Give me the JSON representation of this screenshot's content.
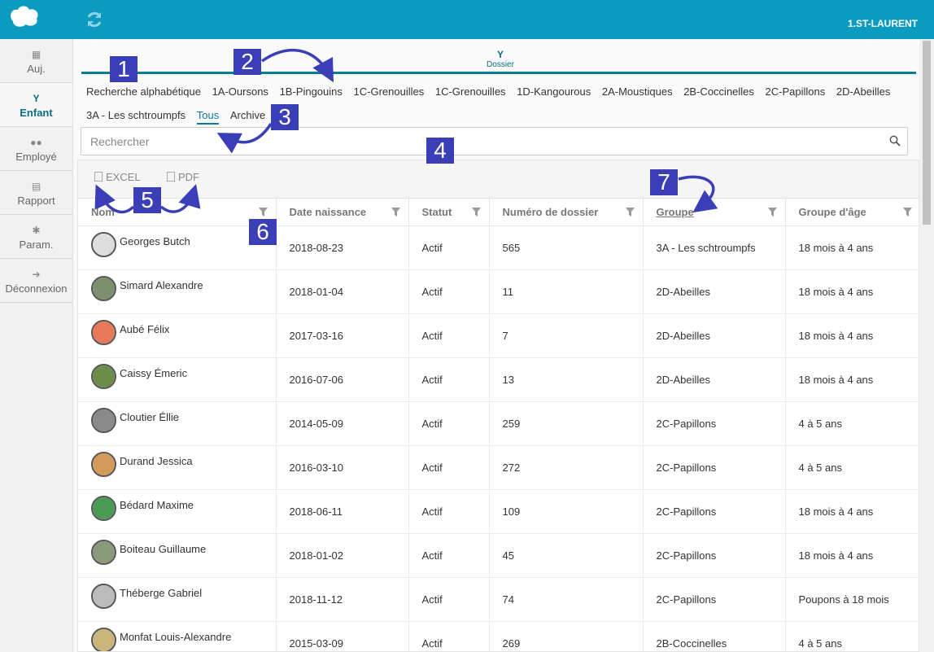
{
  "topbar": {
    "user": "1.ST-LAURENT"
  },
  "sidebar": {
    "items": [
      {
        "label": "Auj.",
        "icon": "calendar-icon",
        "active": false
      },
      {
        "label": "Enfant",
        "icon": "child-icon",
        "active": true
      },
      {
        "label": "Employé",
        "icon": "users-icon",
        "active": false
      },
      {
        "label": "Rapport",
        "icon": "report-icon",
        "active": false
      },
      {
        "label": "Param.",
        "icon": "gear-icon",
        "active": false
      },
      {
        "label": "Déconnexion",
        "icon": "logout-icon",
        "active": false
      }
    ]
  },
  "dossier_tab": "Dossier",
  "filters": {
    "row1": [
      "Recherche alphabétique",
      "1A-Oursons",
      "1B-Pingouins",
      "1C-Grenouilles",
      "1C-Grenouilles",
      "1D-Kangourous",
      "2A-Moustiques",
      "2B-Coccinelles",
      "2C-Papillons",
      "2D-Abeilles"
    ],
    "row2": [
      "3A - Les schtroumpfs",
      "Tous",
      "Archive"
    ],
    "active": "Tous"
  },
  "search": {
    "placeholder": "Rechercher"
  },
  "exports": {
    "excel": "EXCEL",
    "pdf": "PDF"
  },
  "table": {
    "headers": [
      "Nom",
      "Date naissance",
      "Statut",
      "Numéro de dossier",
      "Groupe",
      "Groupe d'âge"
    ],
    "rows": [
      [
        "Georges Butch",
        "2018-08-23",
        "Actif",
        "565",
        "3A - Les schtroumpfs",
        "18 mois à 4 ans"
      ],
      [
        "Simard Alexandre",
        "2018-01-04",
        "Actif",
        "11",
        "2D-Abeilles",
        "18 mois à 4 ans"
      ],
      [
        "Aubé Félix",
        "2017-03-16",
        "Actif",
        "7",
        "2D-Abeilles",
        "18 mois à 4 ans"
      ],
      [
        "Caissy Émeric",
        "2016-07-06",
        "Actif",
        "13",
        "2D-Abeilles",
        "18 mois à 4 ans"
      ],
      [
        "Cloutier Éllie",
        "2014-05-09",
        "Actif",
        "259",
        "2C-Papillons",
        "4 à 5 ans"
      ],
      [
        "Durand Jessica",
        "2016-03-10",
        "Actif",
        "272",
        "2C-Papillons",
        "4 à 5 ans"
      ],
      [
        "Bédard Maxime",
        "2018-06-11",
        "Actif",
        "109",
        "2C-Papillons",
        "18 mois à 4 ans"
      ],
      [
        "Boiteau Guillaume",
        "2018-01-02",
        "Actif",
        "45",
        "2C-Papillons",
        "18 mois à 4 ans"
      ],
      [
        "Théberge Gabriel",
        "2018-11-12",
        "Actif",
        "74",
        "2C-Papillons",
        "Poupons à 18 mois"
      ],
      [
        "Monfat Louis-Alexandre",
        "2015-03-09",
        "Actif",
        "269",
        "2B-Coccinelles",
        "4 à 5 ans"
      ]
    ]
  },
  "annotations": [
    "1",
    "2",
    "3",
    "4",
    "5",
    "6",
    "7"
  ],
  "colors": {
    "topbar": "#0b9bc0",
    "accent": "#0b7a94",
    "annotation": "#3a3fb8"
  }
}
